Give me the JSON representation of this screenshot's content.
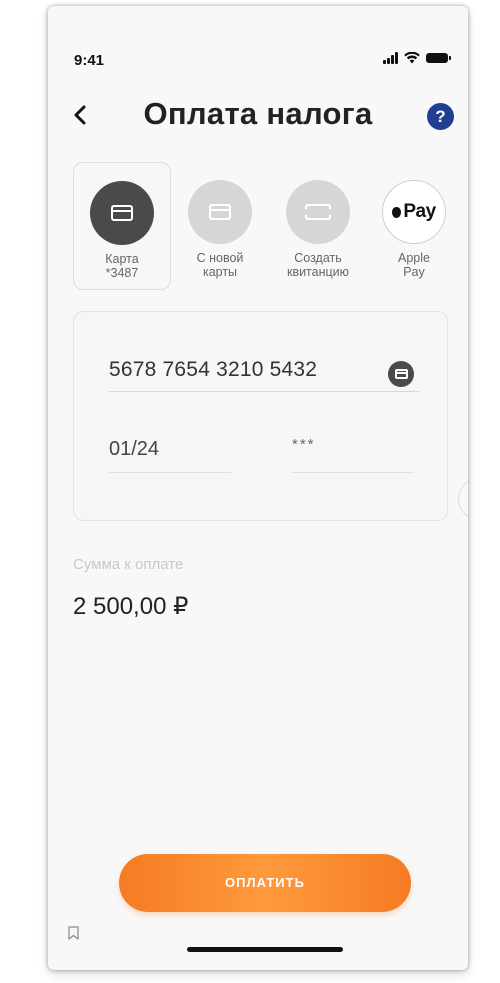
{
  "status_bar": {
    "time": "9:41"
  },
  "header": {
    "title": "Оплата налога",
    "help_label": "?"
  },
  "payment_methods": [
    {
      "label": "Карта\n*3487",
      "icon": "card-icon",
      "selected": true
    },
    {
      "label": "С новой\nкарты",
      "icon": "card-icon",
      "selected": false
    },
    {
      "label": "Создать\nквитанцию",
      "icon": "ticket-icon",
      "selected": false
    },
    {
      "label": "Apple\nPay",
      "icon": "apple-pay-icon",
      "selected": false
    }
  ],
  "apple_pay_mark": "Pay",
  "card_form": {
    "card_number": "5678 7654 3210 5432",
    "expiry": "01/24",
    "cvv": "***"
  },
  "amount": {
    "label": "Сумма к оплате",
    "value": "2 500,00 ₽"
  },
  "pay_button": {
    "label": "ОПЛАТИТЬ"
  },
  "colors": {
    "accent": "#f57b23",
    "help_button": "#1f3f8f",
    "selected_method": "#4a4a4a",
    "inactive_method": "#d6d6d6"
  }
}
